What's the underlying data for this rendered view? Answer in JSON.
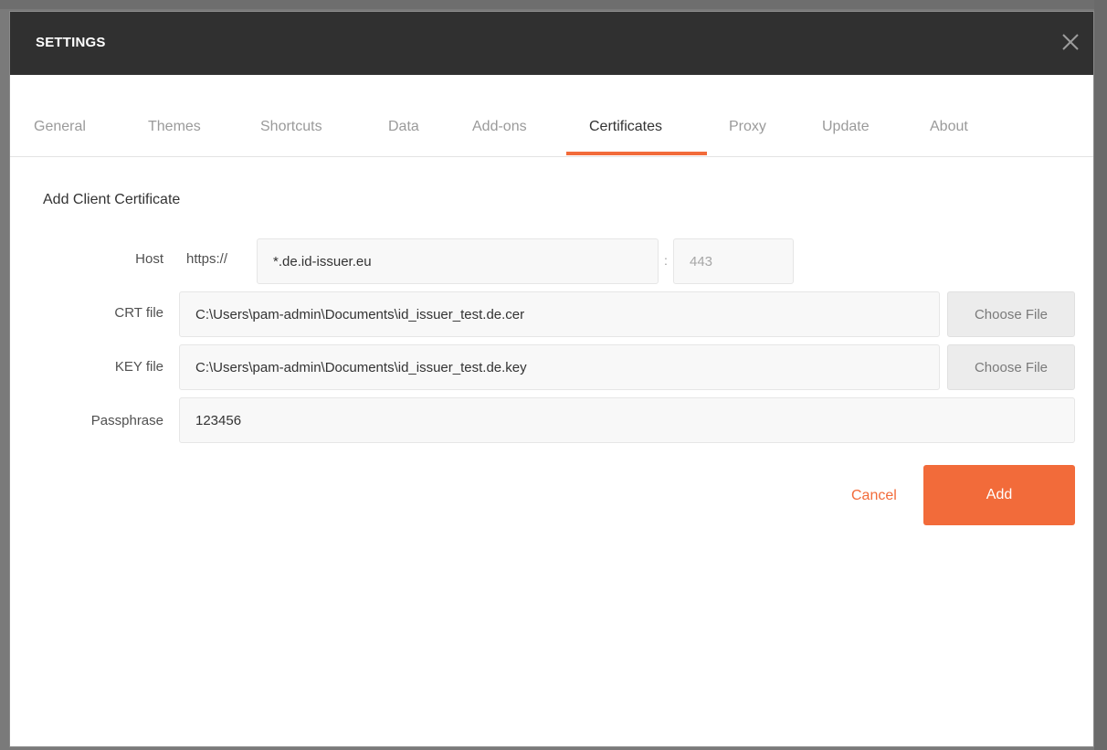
{
  "dialog": {
    "title": "SETTINGS"
  },
  "tabs": [
    {
      "label": "General"
    },
    {
      "label": "Themes"
    },
    {
      "label": "Shortcuts"
    },
    {
      "label": "Data"
    },
    {
      "label": "Add-ons"
    },
    {
      "label": "Certificates",
      "active": true
    },
    {
      "label": "Proxy"
    },
    {
      "label": "Update"
    },
    {
      "label": "About"
    }
  ],
  "form": {
    "section_title": "Add Client Certificate",
    "host": {
      "label": "Host",
      "prefix": "https://",
      "value": "*.de.id-issuer.eu",
      "port_separator": ":",
      "port_placeholder": "443"
    },
    "crt": {
      "label": "CRT file",
      "value": "C:\\Users\\pam-admin\\Documents\\id_issuer_test.de.cer",
      "button": "Choose File"
    },
    "key": {
      "label": "KEY file",
      "value": "C:\\Users\\pam-admin\\Documents\\id_issuer_test.de.key",
      "button": "Choose File"
    },
    "passphrase": {
      "label": "Passphrase",
      "value": "123456"
    },
    "actions": {
      "cancel": "Cancel",
      "add": "Add"
    }
  },
  "colors": {
    "accent": "#f26b3a",
    "titlebar": "#303030"
  },
  "icons": {
    "close": "close-icon"
  }
}
